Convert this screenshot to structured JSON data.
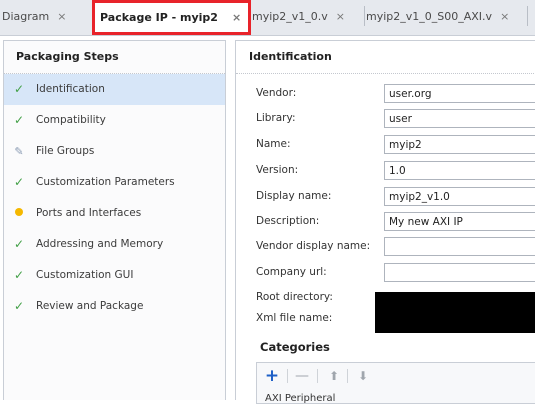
{
  "tabs": [
    {
      "label": "Diagram",
      "close": "×"
    },
    {
      "label": "Package IP - myip2",
      "close": "×",
      "active": true
    },
    {
      "label": "myip2_v1_0.v",
      "close": "×"
    },
    {
      "label": "myip2_v1_0_S00_AXI.v",
      "close": "×"
    }
  ],
  "left_panel": {
    "title": "Packaging Steps",
    "steps": [
      {
        "label": "Identification",
        "status_icon": "check-icon",
        "selected": true
      },
      {
        "label": "Compatibility",
        "status_icon": "check-icon"
      },
      {
        "label": "File Groups",
        "status_icon": "pencil-icon"
      },
      {
        "label": "Customization Parameters",
        "status_icon": "check-icon"
      },
      {
        "label": "Ports and Interfaces",
        "status_icon": "warning-dot-icon"
      },
      {
        "label": "Addressing and Memory",
        "status_icon": "check-icon"
      },
      {
        "label": "Customization GUI",
        "status_icon": "check-icon"
      },
      {
        "label": "Review and Package",
        "status_icon": "check-icon"
      }
    ]
  },
  "identification": {
    "title": "Identification",
    "vendor": {
      "label": "Vendor:",
      "value": "user.org"
    },
    "library": {
      "label": "Library:",
      "value": "user"
    },
    "name": {
      "label": "Name:",
      "value": "myip2"
    },
    "version": {
      "label": "Version:",
      "value": "1.0"
    },
    "display_name": {
      "label": "Display name:",
      "value": "myip2_v1.0"
    },
    "description": {
      "label": "Description:",
      "value": "My new AXI IP"
    },
    "vendor_display_name": {
      "label": "Vendor display name:",
      "value": ""
    },
    "company_url": {
      "label": "Company url:",
      "value": ""
    },
    "root_directory": {
      "label": "Root directory:"
    },
    "xml_file_name": {
      "label": "Xml file name:"
    }
  },
  "categories": {
    "title": "Categories",
    "toolbar": {
      "add": "+",
      "remove": "—",
      "up": "⬆",
      "down": "⬇"
    },
    "items": [
      "AXI Peripheral"
    ]
  },
  "colors": {
    "active_tab_highlight": "#e8232a",
    "selected_step": "#d7e6f8",
    "check": "#43a047",
    "warning_dot": "#f5b800",
    "add_button": "#1e5fc7"
  }
}
